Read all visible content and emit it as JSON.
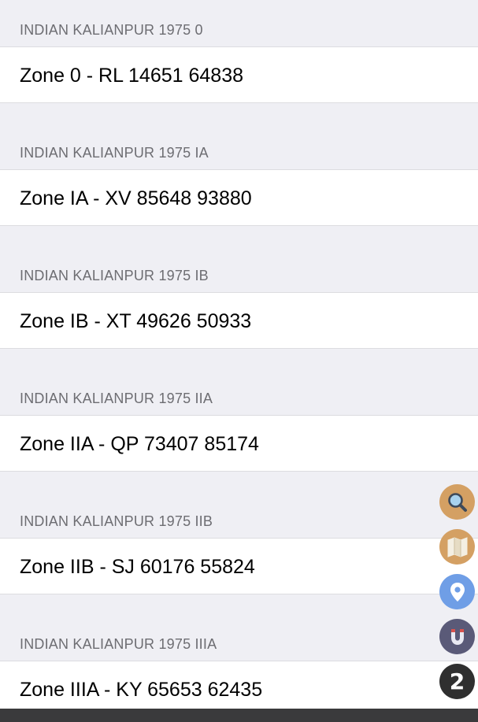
{
  "sections": [
    {
      "header": "INDIAN KALIANPUR 1975 0",
      "value": "Zone 0 - RL 14651 64838"
    },
    {
      "header": "INDIAN KALIANPUR 1975 IA",
      "value": "Zone IA - XV 85648 93880"
    },
    {
      "header": "INDIAN KALIANPUR 1975 IB",
      "value": "Zone IB - XT 49626 50933"
    },
    {
      "header": "INDIAN KALIANPUR 1975 IIA",
      "value": "Zone IIA - QP 73407 85174"
    },
    {
      "header": "INDIAN KALIANPUR 1975 IIB",
      "value": "Zone IIB - SJ 60176 55824"
    },
    {
      "header": "INDIAN KALIANPUR 1975 IIIA",
      "value": "Zone IIIA - KY 65653 62435"
    }
  ],
  "floating_buttons": [
    {
      "icon": "search-icon",
      "color": "#d4a063"
    },
    {
      "icon": "map-icon",
      "color": "#d4a063"
    },
    {
      "icon": "location-pin-icon",
      "color": "#6f9ee6"
    },
    {
      "icon": "magnet-icon",
      "color": "#5a5a78"
    },
    {
      "icon": "number-badge-icon",
      "color": "#2f2f2f",
      "label": "2"
    }
  ],
  "colors": {
    "background": "#efeff4",
    "header_text": "#6d6d72",
    "row_background": "#ffffff",
    "bottom_bar": "#3a3a3c"
  }
}
